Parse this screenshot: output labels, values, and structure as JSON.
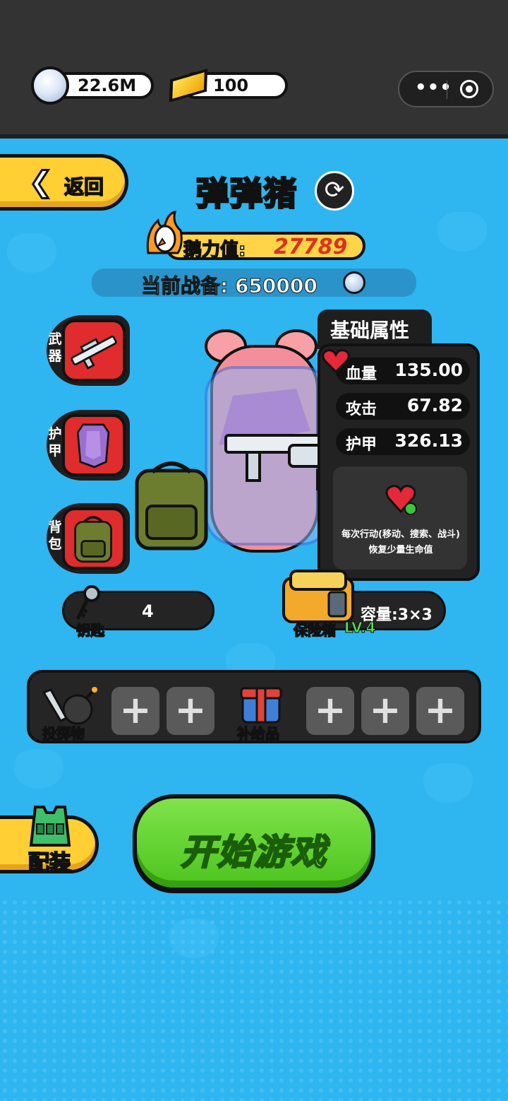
{
  "currency": {
    "silver": "22.6M",
    "gold": "100"
  },
  "header": {
    "back_label": "返回",
    "title": "弹弹猪",
    "power_label": "鹅力值:",
    "power_value": "27789",
    "combat_label": "当前战备: 650000"
  },
  "equipment_slots": [
    {
      "label": "武器",
      "icon": "gun-icon"
    },
    {
      "label": "护甲",
      "icon": "armor-icon"
    },
    {
      "label": "背包",
      "icon": "backpack-icon"
    }
  ],
  "stats": {
    "title": "基础属性",
    "rows": [
      {
        "name": "血量",
        "value": "135.00"
      },
      {
        "name": "攻击",
        "value": "67.82"
      },
      {
        "name": "护甲",
        "value": "326.13"
      }
    ],
    "effect_text": "每次行动(移动、搜索、战斗)恢复少量生命值"
  },
  "keys": {
    "label": "钥匙",
    "count": "4"
  },
  "safe": {
    "label": "保险箱",
    "level": "LV.4",
    "capacity": "容量:3×3"
  },
  "items": {
    "throwable_label": "投掷物",
    "supply_label": "补给品",
    "empty_slot_symbol": "+"
  },
  "loadout_label": "配装",
  "start_label": "开始游戏",
  "colors": {
    "background": "#2fb5f0",
    "accent_yellow": "#ffcf33",
    "start_green": "#4cc41e",
    "slot_red": "#e02c2c",
    "power_value": "#d9331f"
  }
}
